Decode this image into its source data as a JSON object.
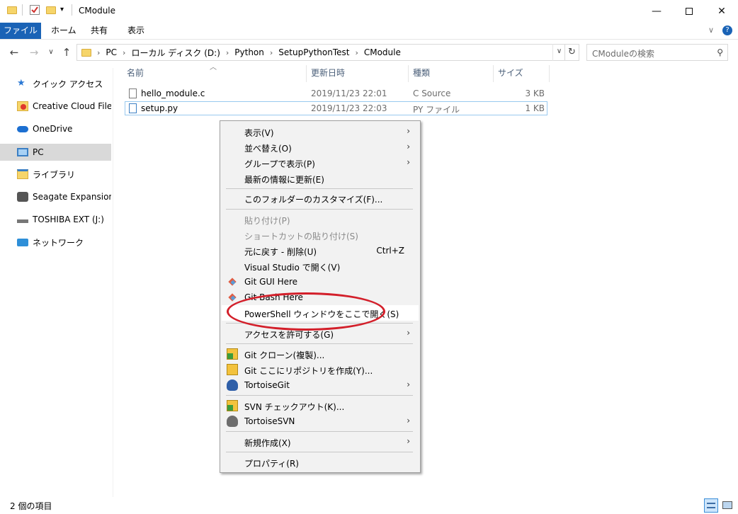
{
  "window": {
    "title": "CModule",
    "controls": [
      "minimize-icon",
      "maximize-icon",
      "close-icon"
    ]
  },
  "ribbon": {
    "tabs": [
      {
        "label": "ファイル",
        "active": true
      },
      {
        "label": "ホーム"
      },
      {
        "label": "共有"
      },
      {
        "label": "表示"
      }
    ]
  },
  "address": {
    "crumbs": [
      "PC",
      "ローカル ディスク (D:)",
      "Python",
      "SetupPythonTest",
      "CModule"
    ],
    "search_placeholder": "CModuleの検索"
  },
  "nav_pane": {
    "items": [
      {
        "label": "クイック アクセス",
        "icon": "star-icon"
      },
      {
        "label": "Creative Cloud Files",
        "icon": "creative-cloud-icon"
      },
      {
        "label": "OneDrive",
        "icon": "cloud-icon"
      },
      {
        "label": "PC",
        "icon": "pc-icon",
        "selected": true
      },
      {
        "label": "ライブラリ",
        "icon": "library-icon"
      },
      {
        "label": "Seagate Expansion Dr",
        "icon": "drive-icon"
      },
      {
        "label": "TOSHIBA EXT (J:)",
        "icon": "usb-drive-icon"
      },
      {
        "label": "ネットワーク",
        "icon": "network-icon"
      }
    ]
  },
  "file_list": {
    "columns": [
      "名前",
      "更新日時",
      "種類",
      "サイズ"
    ],
    "rows": [
      {
        "name": "hello_module.c",
        "modified": "2019/11/23 22:01",
        "type": "C Source",
        "size": "3 KB"
      },
      {
        "name": "setup.py",
        "modified": "2019/11/23 22:03",
        "type": "PY ファイル",
        "size": "1 KB",
        "selected": true
      }
    ]
  },
  "context_menu": {
    "items": [
      {
        "label": "表示(V)",
        "submenu": true
      },
      {
        "label": "並べ替え(O)",
        "submenu": true
      },
      {
        "label": "グループで表示(P)",
        "submenu": true
      },
      {
        "label": "最新の情報に更新(E)"
      },
      {
        "label": "このフォルダーのカスタマイズ(F)..."
      },
      {
        "label": "貼り付け(P)",
        "disabled": true
      },
      {
        "label": "ショートカットの貼り付け(S)",
        "disabled": true
      },
      {
        "label": "元に戻す - 削除(U)",
        "shortcut": "Ctrl+Z"
      },
      {
        "label": "Visual Studio で開く(V)"
      },
      {
        "label": "Git GUI Here",
        "icon": "git-icon"
      },
      {
        "label": "Git Bash Here",
        "icon": "git-icon"
      },
      {
        "label": "PowerShell ウィンドウをここで開く(S)",
        "highlighted": true
      },
      {
        "label": "アクセスを許可する(G)",
        "submenu": true
      },
      {
        "label": "Git クローン(複製)...",
        "icon": "tortoisegit-clone-icon"
      },
      {
        "label": "Git ここにリポジトリを作成(Y)...",
        "icon": "tortoisegit-create-icon"
      },
      {
        "label": "TortoiseGit",
        "icon": "tortoisegit-icon",
        "submenu": true
      },
      {
        "label": "SVN チェックアウト(K)...",
        "icon": "svn-checkout-icon"
      },
      {
        "label": "TortoiseSVN",
        "icon": "tortoisesvn-icon",
        "submenu": true
      },
      {
        "label": "新規作成(X)",
        "submenu": true
      },
      {
        "label": "プロパティ(R)"
      }
    ]
  },
  "status_bar": {
    "item_count": "2 個の項目"
  },
  "colors": {
    "file_tab": "#1a63b6",
    "selection": "#d9d9d9",
    "highlight_ellipse": "#d31f2a"
  }
}
